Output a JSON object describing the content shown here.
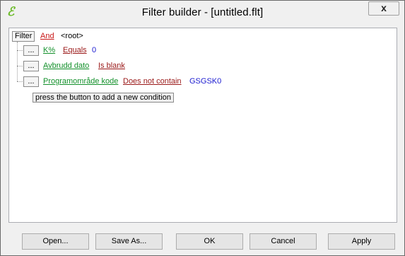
{
  "window": {
    "title": "Filter builder - [untitled.flt]",
    "close_glyph": "x",
    "app_icon": "filter-app-icon"
  },
  "tree": {
    "root_button": "Filter",
    "root_operator": "And",
    "root_label": "<root>",
    "conditions": [
      {
        "button": "...",
        "field": "K%",
        "operator": "Equals",
        "value": "0"
      },
      {
        "button": "...",
        "field": "Avbrudd dato",
        "operator": "Is blank",
        "value": ""
      },
      {
        "button": "...",
        "field": "Programområde kode",
        "operator": "Does not contain",
        "value": "GSGSK0"
      }
    ],
    "add_hint": "press the button to add a new condition"
  },
  "buttons": {
    "open": "Open...",
    "save_as": "Save As...",
    "ok": "OK",
    "cancel": "Cancel",
    "apply": "Apply"
  },
  "colors": {
    "field": "#12902a",
    "operator": "#9a1818",
    "root_operator": "#c81414",
    "value": "#1a1ad0"
  }
}
